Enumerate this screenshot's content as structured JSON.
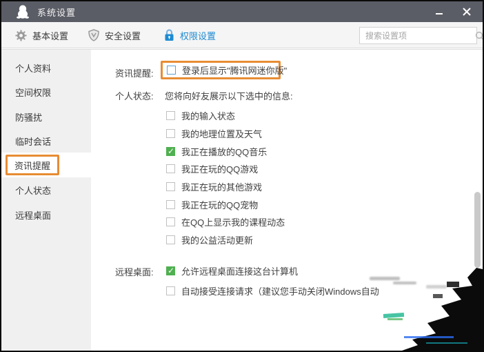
{
  "window": {
    "title": "系统设置"
  },
  "tabs": [
    {
      "label": "基本设置",
      "icon": "gear-icon",
      "active": false
    },
    {
      "label": "安全设置",
      "icon": "shield-icon",
      "active": false
    },
    {
      "label": "权限设置",
      "icon": "lock-icon",
      "active": true
    }
  ],
  "search": {
    "placeholder": "搜索设置项",
    "icon": "search-icon"
  },
  "sidebar": {
    "items": [
      {
        "label": "个人资料",
        "selected": false
      },
      {
        "label": "空间权限",
        "selected": false
      },
      {
        "label": "防骚扰",
        "selected": false
      },
      {
        "label": "临时会话",
        "selected": false
      },
      {
        "label": "资讯提醒",
        "selected": true,
        "highlighted": true
      },
      {
        "label": "个人状态",
        "selected": false
      },
      {
        "label": "远程桌面",
        "selected": false
      }
    ]
  },
  "content": {
    "news_section": {
      "label": "资讯提醒:",
      "highlighted": true,
      "option": {
        "label": "登录后显示\"腾讯网迷你版\"",
        "checked": false
      }
    },
    "status_section": {
      "label": "个人状态:",
      "description": "您将向好友展示以下选中的信息:",
      "options": [
        {
          "label": "我的输入状态",
          "checked": false
        },
        {
          "label": "我的地理位置及天气",
          "checked": false
        },
        {
          "label": "我正在播放的QQ音乐",
          "checked": true
        },
        {
          "label": "我正在玩的QQ游戏",
          "checked": false
        },
        {
          "label": "我正在玩的其他游戏",
          "checked": false
        },
        {
          "label": "我正在玩的QQ宠物",
          "checked": false
        },
        {
          "label": "在QQ上显示我的课程动态",
          "checked": false
        },
        {
          "label": "我的公益活动更新",
          "checked": false
        }
      ]
    },
    "remote_section": {
      "label": "远程桌面:",
      "options": [
        {
          "label": "允许远程桌面连接这台计算机",
          "checked": true
        },
        {
          "label": "自动接受连接请求（建议您手动关闭Windows自动",
          "checked": false
        }
      ]
    }
  },
  "colors": {
    "titlebar": "#5b5d66",
    "accent_blue": "#1e8bd2",
    "highlight_orange": "#e78c33",
    "checked_green": "#4fb050"
  }
}
